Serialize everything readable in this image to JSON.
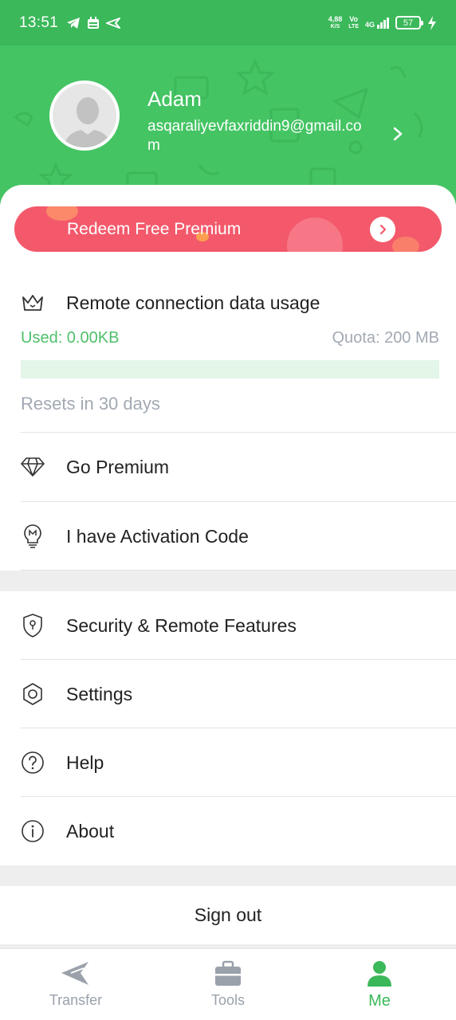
{
  "status_bar": {
    "time": "13:51",
    "net_speed_top": "4,88",
    "net_speed_bottom": "K/S",
    "volte_top": "Vo",
    "volte_bottom": "LTE",
    "network": "4G",
    "battery": "57"
  },
  "profile": {
    "name": "Adam",
    "email": "asqaraliyevfaxriddin9@gmail.com"
  },
  "redeem": {
    "label": "Redeem Free Premium"
  },
  "usage": {
    "title": "Remote connection data usage",
    "used": "Used: 0.00KB",
    "quota": "Quota: 200 MB",
    "fraction": 0,
    "resets": "Resets in 30 days"
  },
  "menu_primary": {
    "go_premium": "Go Premium",
    "activation": "I have Activation Code"
  },
  "menu_secondary": {
    "security": "Security & Remote Features",
    "settings": "Settings",
    "help": "Help",
    "about": "About"
  },
  "sign_out": "Sign out",
  "bottom_nav": {
    "transfer": "Transfer",
    "tools": "Tools",
    "me": "Me"
  },
  "colors": {
    "brand_green": "#44c463",
    "redeem_red": "#f3596b",
    "muted_text": "#a2a9b3"
  }
}
